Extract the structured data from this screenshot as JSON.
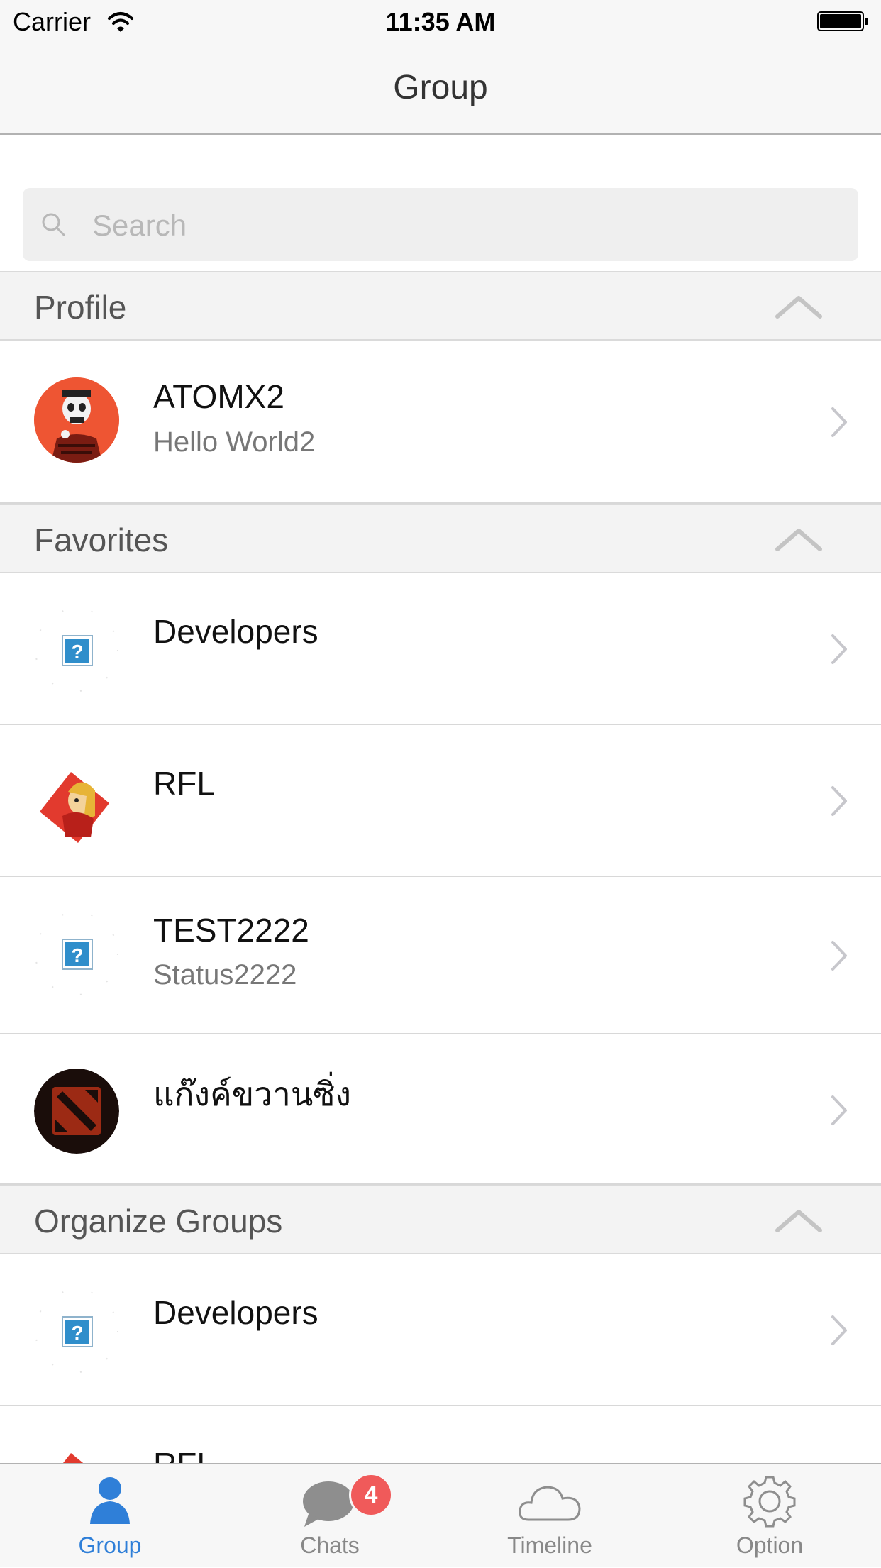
{
  "status_bar": {
    "carrier": "Carrier",
    "time": "11:35 AM"
  },
  "nav": {
    "title": "Group"
  },
  "search": {
    "placeholder": "Search"
  },
  "sections": {
    "profile": {
      "title": "Profile"
    },
    "favorites": {
      "title": "Favorites"
    },
    "organize": {
      "title": "Organize Groups"
    }
  },
  "profile": {
    "name": "ATOMX2",
    "status": "Hello World2"
  },
  "favorites": [
    {
      "name": "Developers",
      "status": "",
      "avatar": "placeholder-icon"
    },
    {
      "name": "RFL",
      "status": "",
      "avatar": "cartoon-character-icon"
    },
    {
      "name": "TEST2222",
      "status": "Status2222",
      "avatar": "placeholder-icon"
    },
    {
      "name": "แก๊งค์ขวานซิ่ง",
      "status": "",
      "avatar": "dota-logo-icon"
    }
  ],
  "organize_groups": [
    {
      "name": "Developers",
      "status": "",
      "avatar": "placeholder-icon"
    },
    {
      "name": "RFL",
      "status": "",
      "avatar": "cartoon-character-icon"
    }
  ],
  "tabs": [
    {
      "label": "Group",
      "icon": "person-icon",
      "active": true
    },
    {
      "label": "Chats",
      "icon": "chat-bubble-icon",
      "badge": "4"
    },
    {
      "label": "Timeline",
      "icon": "cloud-icon"
    },
    {
      "label": "Option",
      "icon": "gear-icon"
    }
  ],
  "colors": {
    "accent": "#2f7fd8",
    "badge": "#f05a5a",
    "profile_avatar_bg": "#ee5533",
    "section_bg": "#f3f3f3"
  }
}
